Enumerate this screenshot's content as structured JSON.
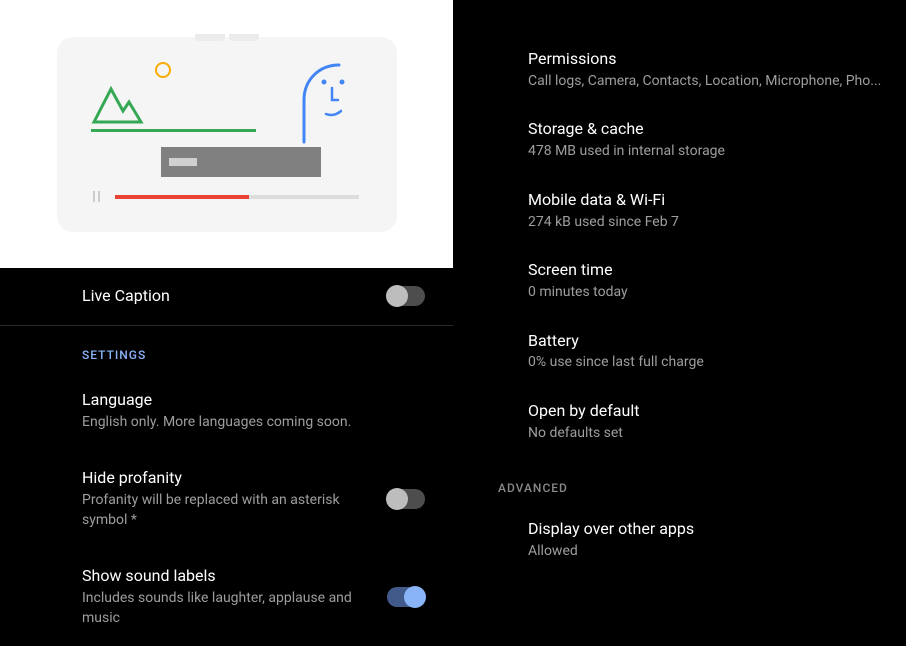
{
  "left": {
    "liveCaption": {
      "title": "Live Caption",
      "toggled": false
    },
    "sectionHeader": "SETTINGS",
    "language": {
      "title": "Language",
      "subtitle": "English only. More languages coming soon."
    },
    "hideProfanity": {
      "title": "Hide profanity",
      "subtitle": "Profanity will be replaced with an asterisk symbol *",
      "toggled": false
    },
    "showSoundLabels": {
      "title": "Show sound labels",
      "subtitle": "Includes sounds like laughter, applause and music",
      "toggled": true
    }
  },
  "right": {
    "permissions": {
      "title": "Permissions",
      "subtitle": "Call logs, Camera, Contacts, Location, Microphone, Pho..."
    },
    "storage": {
      "title": "Storage & cache",
      "subtitle": "478 MB used in internal storage"
    },
    "mobileData": {
      "title": "Mobile data & Wi-Fi",
      "subtitle": "274 kB used since Feb 7"
    },
    "screenTime": {
      "title": "Screen time",
      "subtitle": "0 minutes today"
    },
    "battery": {
      "title": "Battery",
      "subtitle": "0% use since last full charge"
    },
    "openByDefault": {
      "title": "Open by default",
      "subtitle": "No defaults set"
    },
    "advancedHeader": "ADVANCED",
    "displayOver": {
      "title": "Display over other apps",
      "subtitle": "Allowed"
    }
  }
}
